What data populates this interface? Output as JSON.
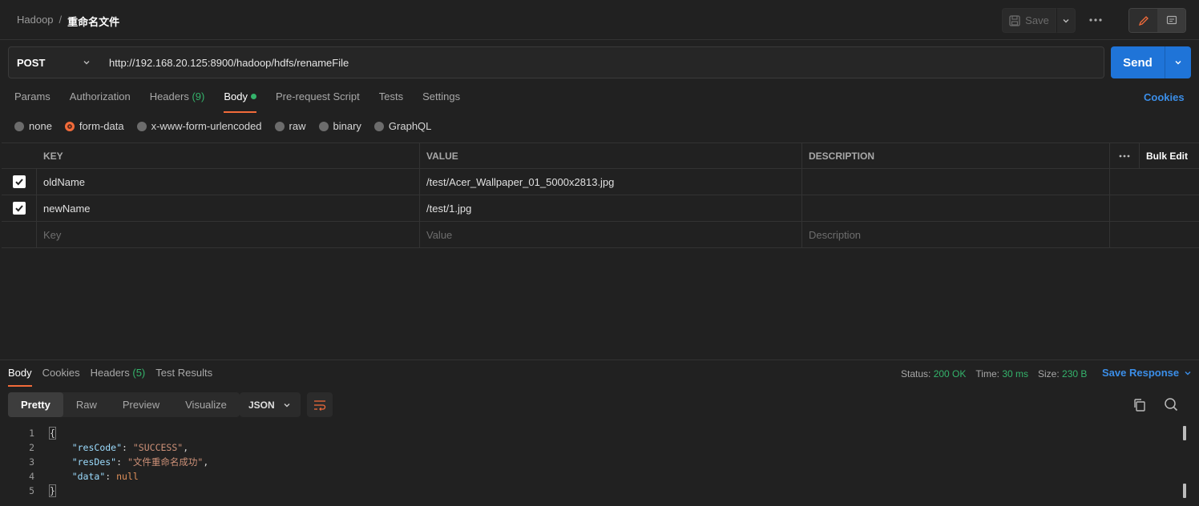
{
  "header": {
    "breadcrumb_parent": "Hadoop",
    "breadcrumb_sep": "/",
    "breadcrumb_current": "重命名文件",
    "save_label": "Save"
  },
  "request": {
    "method": "POST",
    "url": "http://192.168.20.125:8900/hadoop/hdfs/renameFile",
    "send_label": "Send"
  },
  "req_tabs": {
    "params": "Params",
    "authorization": "Authorization",
    "headers": "Headers",
    "headers_count": "(9)",
    "body": "Body",
    "pre_request": "Pre-request Script",
    "tests": "Tests",
    "settings": "Settings",
    "cookies": "Cookies"
  },
  "body_types": {
    "none": "none",
    "form_data": "form-data",
    "urlencoded": "x-www-form-urlencoded",
    "raw": "raw",
    "binary": "binary",
    "graphql": "GraphQL"
  },
  "kv_table": {
    "col_key": "KEY",
    "col_value": "VALUE",
    "col_description": "DESCRIPTION",
    "bulk_edit": "Bulk Edit",
    "rows": [
      {
        "key": "oldName",
        "value": "/test/Acer_Wallpaper_01_5000x2813.jpg",
        "description": ""
      },
      {
        "key": "newName",
        "value": "/test/1.jpg",
        "description": ""
      }
    ],
    "placeholder_key": "Key",
    "placeholder_value": "Value",
    "placeholder_description": "Description"
  },
  "response": {
    "tabs": {
      "body": "Body",
      "cookies": "Cookies",
      "headers": "Headers",
      "headers_count": "(5)",
      "test_results": "Test Results"
    },
    "status_label": "Status:",
    "status_value": "200 OK",
    "time_label": "Time:",
    "time_value": "30 ms",
    "size_label": "Size:",
    "size_value": "230 B",
    "save_response": "Save Response",
    "views": {
      "pretty": "Pretty",
      "raw": "Raw",
      "preview": "Preview",
      "visualize": "Visualize"
    },
    "format": "JSON",
    "code": {
      "line_numbers": [
        "1",
        "2",
        "3",
        "4",
        "5"
      ],
      "open_brace": "{",
      "close_brace": "}",
      "k1": "\"resCode\"",
      "v1": "\"SUCCESS\"",
      "k2": "\"resDes\"",
      "v2": "\"文件重命名成功\"",
      "k3": "\"data\"",
      "v3": "null"
    }
  },
  "colors": {
    "accent_orange": "#f26b3a",
    "send_blue": "#1f74d8",
    "link_blue": "#3b8ee8",
    "success_green": "#34b36b"
  }
}
